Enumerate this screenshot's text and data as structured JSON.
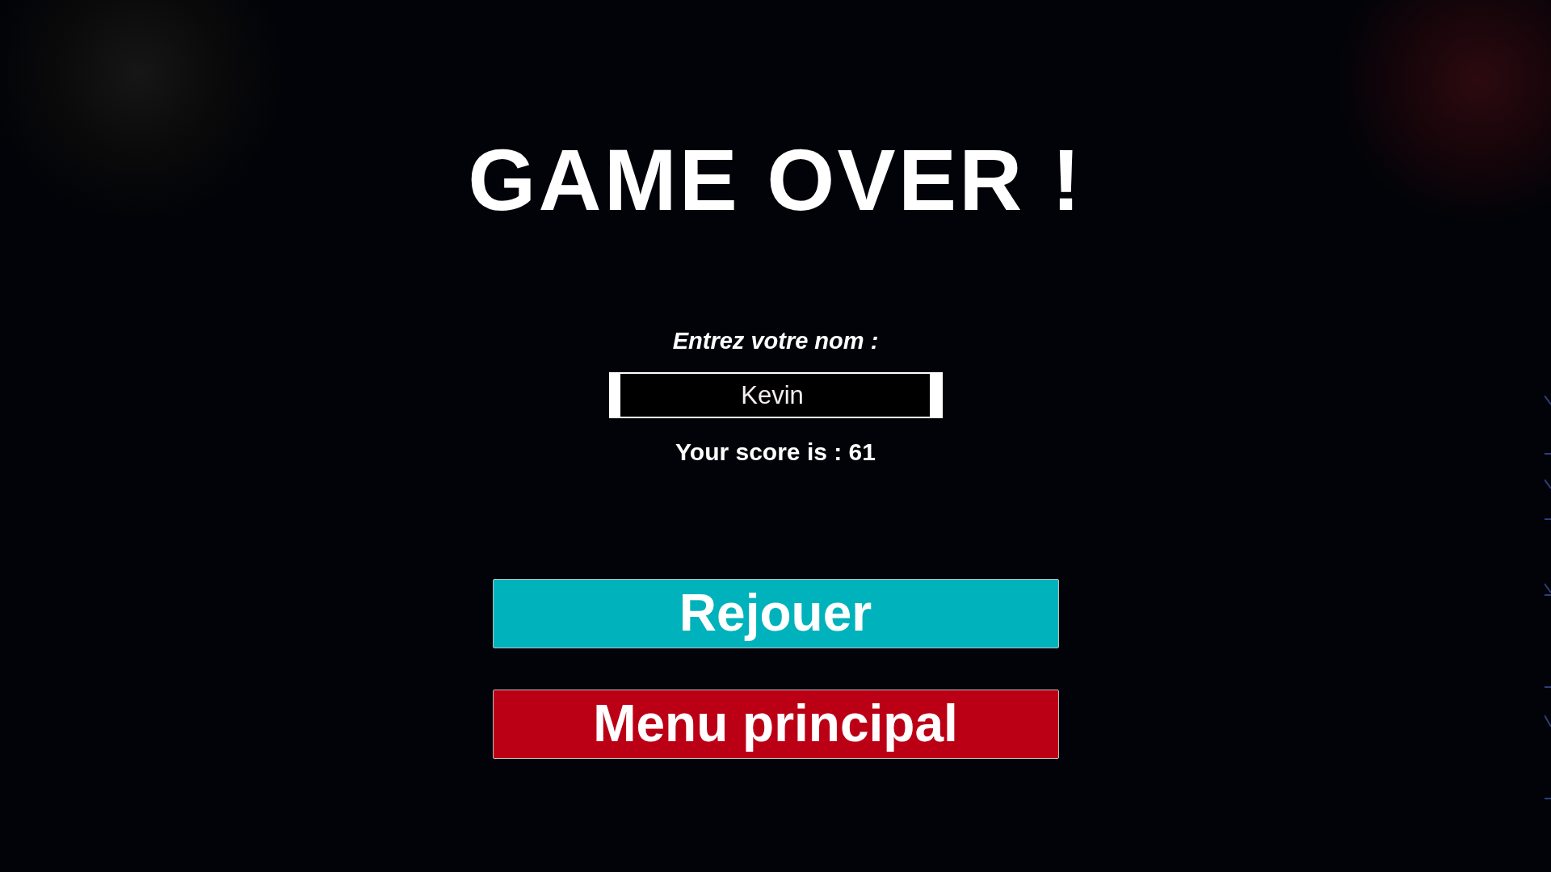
{
  "title": "GAME OVER !",
  "name_prompt": {
    "label": "Entrez votre nom :",
    "value": "Kevin"
  },
  "score": "Your score is : 61",
  "buttons": [
    {
      "label": "Rejouer",
      "color": "#00b2bb"
    },
    {
      "label": "Menu principal",
      "color": "#bb0016"
    }
  ]
}
